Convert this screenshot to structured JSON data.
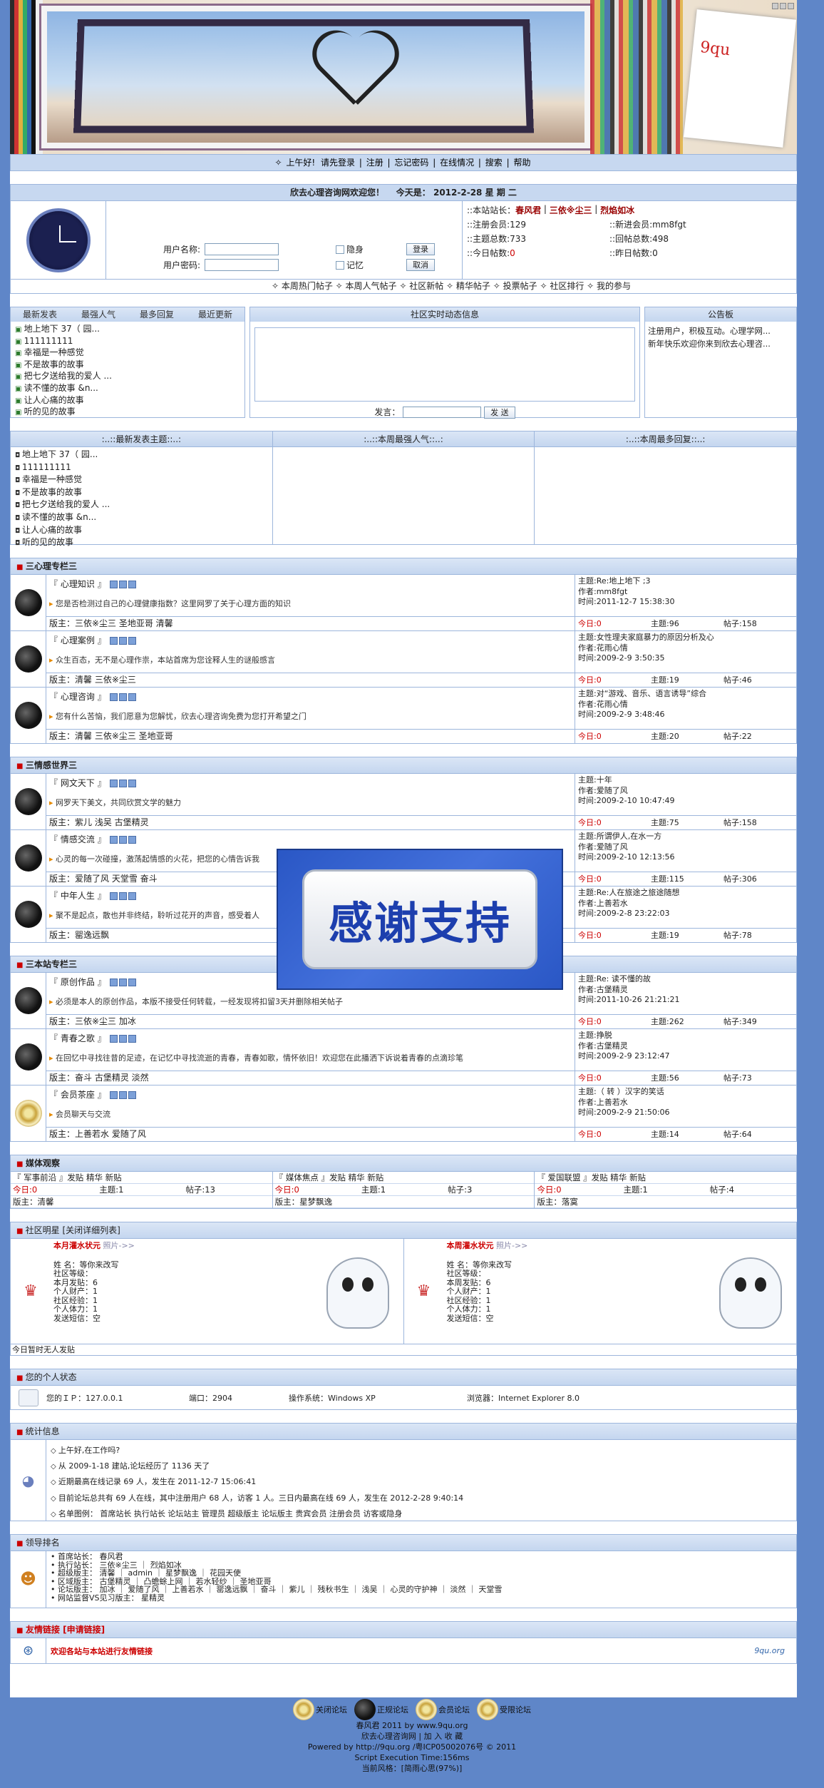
{
  "menu": {
    "items": [
      "上午好!",
      "请先登录",
      "注册",
      "忘记密码",
      "在线情况",
      "搜索",
      "帮助"
    ]
  },
  "welcome": {
    "text": "欣去心理咨询网欢迎您！",
    "today_label": "今天是：",
    "date": "2012-2-28 星 期 二"
  },
  "login": {
    "username_label": "用户名称:",
    "password_label": "用户密码:",
    "hidden_label": "隐身",
    "remember_label": "记忆",
    "login_button": "登录",
    "cancel_button": "取消"
  },
  "site_stats": {
    "admins_label": "::本站站长：",
    "admins": [
      "春风君",
      "三依※尘三",
      "烈焰如冰"
    ],
    "registered": "::注册会员:129",
    "newest": "::新进会员:mm8fgt",
    "topics_total": "::主题总数:733",
    "posts_total": "::回帖总数:498",
    "today_label": "::今日帖数:",
    "today_value": "0",
    "yesterday": "::昨日帖数:0"
  },
  "quicknav": [
    "本周热门帖子",
    "本周人气帖子",
    "社区新帖",
    "精华帖子",
    "投票帖子",
    "社区排行",
    "我的参与"
  ],
  "panel_tabs": [
    "最新发表",
    "最强人气",
    "最多回复",
    "最近更新"
  ],
  "latest_topics": [
    "地上地下 37（ 园...",
    "111111111",
    "幸福是一种感觉",
    "不是故事的故事",
    "把七夕送给我的爱人 ...",
    "读不懂的故事 &n...",
    "让人心痛的故事",
    "听的见的故事"
  ],
  "chat": {
    "title": "社区实时动态信息",
    "say_label": "发言：",
    "send_button": "发 送"
  },
  "notice": {
    "title": "公告板",
    "lines": [
      "注册用户，积极互动。心理学网...",
      "新年快乐欢迎你来到欣去心理咨..."
    ]
  },
  "week_cols": [
    ":..::最新发表主题::..:",
    ":..::本周最强人气::..:",
    ":..::本周最多回复::..:"
  ],
  "categories": [
    {
      "title": "三心理专栏三",
      "forums": [
        {
          "name": "『 心理知识 』",
          "desc": "您是否检测过自己的心理健康指数？这里网罗了关于心理方面的知识",
          "mods": "版主：三依※尘三 圣地亚哥 清馨",
          "last_topic": "主题:Re:地上地下 ;3",
          "last_author": "作者:mm8fgt",
          "last_time": "时间:2011-12-7 15:38:30",
          "today": "今日:0",
          "topics": "主题:96",
          "posts": "帖子:158"
        },
        {
          "name": "『 心理案例 』",
          "desc": "众生百态，无不是心理作祟，本站首席为您诠释人生的谜般感言",
          "mods": "版主：清馨 三依※尘三",
          "last_topic": "主题:女性理夫家庭暴力的原因分析及心",
          "last_author": "作者:花雨心情",
          "last_time": "时间:2009-2-9 3:50:35",
          "today": "今日:0",
          "topics": "主题:19",
          "posts": "帖子:46"
        },
        {
          "name": "『 心理咨询 』",
          "desc": "您有什么苦恼，我们愿意为您解忧，欣去心理咨询免费为您打开希望之门",
          "mods": "版主：清馨 三依※尘三 圣地亚哥",
          "last_topic": "主题:对“游戏、音乐、语言诱导”综合",
          "last_author": "作者:花雨心情",
          "last_time": "时间:2009-2-9 3:48:46",
          "today": "今日:0",
          "topics": "主题:20",
          "posts": "帖子:22"
        }
      ]
    },
    {
      "title": "三情感世界三",
      "forums": [
        {
          "name": "『 网文天下 』",
          "desc": "网罗天下美文，共同欣赏文学的魅力",
          "mods": "版主：紫儿 浅吴 古堡精灵",
          "last_topic": "主题:十年",
          "last_author": "作者:爱随了风",
          "last_time": "时间:2009-2-10 10:47:49",
          "today": "今日:0",
          "topics": "主题:75",
          "posts": "帖子:158"
        },
        {
          "name": "『 情感交流 』",
          "desc": "心灵的每一次碰撞，激荡起情感的火花，把您的心情告诉我",
          "mods": "版主：爱随了风 天堂雪 奋斗",
          "last_topic": "主题:所谓伊人,在水一方",
          "last_author": "作者:爱随了风",
          "last_time": "时间:2009-2-10 12:13:56",
          "today": "今日:0",
          "topics": "主题:115",
          "posts": "帖子:306"
        },
        {
          "name": "『 中年人生 』",
          "desc": "聚不是起点，散也并非终结，聆听过花开的声音，感受着人",
          "mods": "版主：罂逸远飘",
          "last_topic": "主题:Re:人在旅途之旅途随想",
          "last_author": "作者:上善若水",
          "last_time": "时间:2009-2-8 23:22:03",
          "today": "今日:0",
          "topics": "主题:19",
          "posts": "帖子:78"
        }
      ]
    },
    {
      "title": "三本站专栏三",
      "forums": [
        {
          "name": "『 原创作品 』",
          "desc": "必须是本人的原创作品，本版不接受任何转载，一经发现将扣留3天并删除相关帖子",
          "mods": "版主：三依※尘三 加冰",
          "last_topic": "主题:Re: 读不懂的故",
          "last_author": "作者:古堡精灵",
          "last_time": "时间:2011-10-26 21:21:21",
          "today": "今日:0",
          "topics": "主题:262",
          "posts": "帖子:349"
        },
        {
          "name": "『 青春之歌 』",
          "desc": "在回忆中寻找往昔的足迹，在记忆中寻找流逝的青春，青春如歌，情怀依旧！欢迎您在此播洒下诉说着青春的点滴珍笔",
          "mods": "版主：奋斗 古堡精灵 淡然",
          "last_topic": "主题:挣脱",
          "last_author": "作者:古堡精灵",
          "last_time": "时间:2009-2-9 23:12:47",
          "today": "今日:0",
          "topics": "主题:56",
          "posts": "帖子:73"
        },
        {
          "name": "『 会员茶座 』",
          "desc": "会员聊天与交流",
          "mods": "版主：上善若水 爱随了风",
          "last_topic": "主题:（ 转 ）汉字的笑话",
          "last_author": "作者:上善若水",
          "last_time": "时间:2009-2-9 21:50:06",
          "today": "今日:0",
          "topics": "主题:14",
          "posts": "帖子:64"
        }
      ]
    }
  ],
  "media": {
    "title": "媒体观察",
    "cols": [
      {
        "name": "『 军事前沿 』发贴 精华 新贴",
        "today": "今日:0",
        "topics": "主题:1",
        "posts": "帖子:13",
        "mods": "版主：清馨"
      },
      {
        "name": "『 媒体焦点 』发贴 精华 新贴",
        "today": "今日:0",
        "topics": "主题:1",
        "posts": "帖子:3",
        "mods": "版主：星梦飘逸"
      },
      {
        "name": "『 爱国联盟 』发贴 精华 新贴",
        "today": "今日:0",
        "topics": "主题:1",
        "posts": "帖子:4",
        "mods": "版主：落寞"
      }
    ]
  },
  "stars": {
    "title": "社区明星 [关闭详细列表]",
    "cards": [
      {
        "head": "本月灌水状元",
        "photo": "照片->>",
        "lines": [
          "姓    名：等你来改写",
          "社区等级：",
          "本月发贴：6",
          "个人财产：1",
          "社区经验：1",
          "个人体力：1",
          "发送短信：空"
        ]
      },
      {
        "head": "本周灌水状元",
        "photo": "照片->>",
        "lines": [
          "姓    名：等你来改写",
          "社区等级：",
          "本周发贴：6",
          "个人财产：1",
          "社区经验：1",
          "个人体力：1",
          "发送短信：空"
        ]
      }
    ],
    "nobody": "今日暂时无人发贴"
  },
  "mystatus": {
    "title": "您的个人状态",
    "ip": "您的ＩＰ：127.0.0.1",
    "port": "端口：2904",
    "os": "操作系统：Windows XP",
    "browser": "浏览器：Internet Explorer 8.0"
  },
  "statistics": {
    "title": "统计信息",
    "lines": [
      "上午好,在工作吗?",
      "从 2009-1-18 建站,论坛经历了 1136 天了",
      "近期最高在线记录 69 人，发生在 2011-12-7 15:06:41",
      "目前论坛总共有 69 人在线，其中注册用户 68 人，访客 1 人。三日内最高在线 69 人，发生在 2012-2-28 9:40:14",
      "名单图例： 首席站长 执行站长 论坛站主 管理员 超级版主 论坛版主 贵宾会员 注册会员 访客或隐身"
    ]
  },
  "leaders": {
    "title": "领导排名",
    "lines": [
      "首席站长： 春风君",
      "执行站长： 三依※尘三 ｜ 烈焰如冰",
      "超级版主： 清馨 ｜ admin ｜ 星梦飘逸 ｜ 花园天使",
      "区域版主： 古堡精灵 ｜ 凸蟾蜍上网 ｜ 若水轻纱 ｜ 圣地亚哥",
      "论坛版主： 加冰 ｜ 爱随了风 ｜ 上善若水 ｜ 罂逸远飘 ｜ 奋斗 ｜ 紫儿 ｜ 残秋书生 ｜ 浅吴 ｜ 心灵的守护神 ｜ 淡然 ｜ 天堂雪",
      "网站监督VS见习版主： 星精灵"
    ]
  },
  "friend_links": {
    "title": "友情链接  [申请链接]",
    "text": "欢迎各站与本站进行友情链接",
    "logo": "9qu.org"
  },
  "footer": {
    "icons": [
      "关闭论坛",
      "正规论坛",
      "会员论坛",
      "受限论坛"
    ],
    "lines": [
      "春风君 2011 by www.9qu.org",
      "欣去心理咨询网 | 加 入 收 藏",
      "Powered by http://9qu.org /粤ICP05002076号 © 2011",
      "Script Execution Time:156ms",
      "当前风格：[简雨心思(97%)]"
    ]
  },
  "overlay": {
    "text": "感谢支持"
  }
}
